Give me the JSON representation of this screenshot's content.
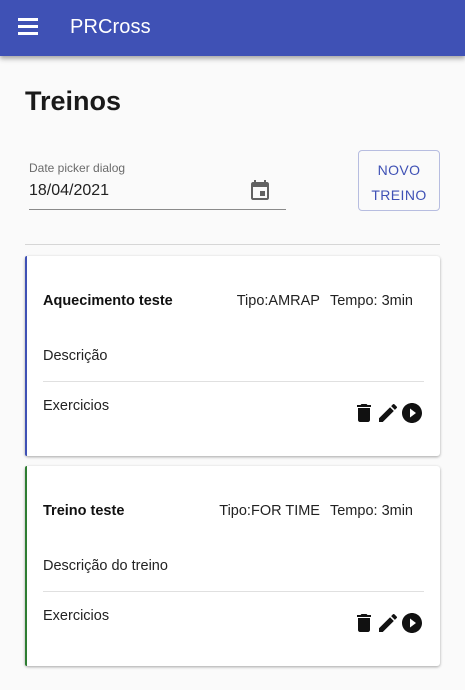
{
  "app": {
    "title": "PRCross"
  },
  "page": {
    "title": "Treinos"
  },
  "date_picker": {
    "label": "Date picker dialog",
    "value": "18/04/2021"
  },
  "new_button": {
    "line1": "NOVO",
    "line2": "TREINO"
  },
  "colors": {
    "primary": "#3f51b5",
    "card1_accent": "#3f51b5",
    "card2_accent": "#2e7d32"
  },
  "workouts": [
    {
      "name": "Aquecimento teste",
      "tipo": "Tipo:AMRAP",
      "tempo": "Tempo: 3min",
      "descricao": "Descrição",
      "exercicios": "Exercicios"
    },
    {
      "name": "Treino teste",
      "tipo": "Tipo:FOR TIME",
      "tempo": "Tempo: 3min",
      "descricao": "Descrição do treino",
      "exercicios": "Exercicios"
    }
  ],
  "icons": {
    "menu": "menu-icon",
    "calendar": "calendar-icon",
    "delete": "delete-icon",
    "edit": "edit-icon",
    "play": "play-circle-icon"
  }
}
